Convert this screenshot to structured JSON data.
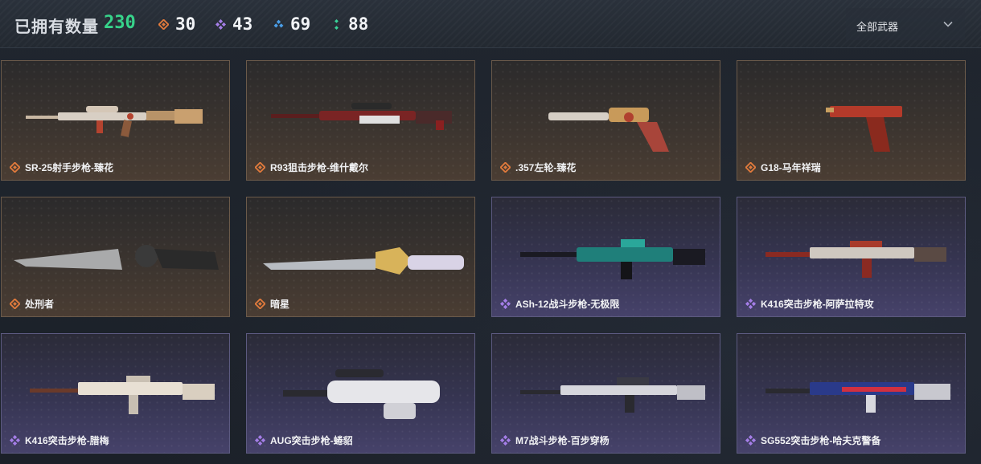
{
  "header": {
    "owned_label": "已拥有数量",
    "owned_count": "230",
    "stats": [
      {
        "icon": "orange-diamond-icon",
        "color": "#e07a3c",
        "count": "30"
      },
      {
        "icon": "purple-diamond-icon",
        "color": "#a57ee8",
        "count": "43"
      },
      {
        "icon": "blue-diamond-icon",
        "color": "#4a9ee8",
        "count": "69"
      },
      {
        "icon": "green-diamond-icon",
        "color": "#39d49a",
        "count": "88"
      }
    ],
    "filter": {
      "label": "全部武器",
      "icon": "chevron-down-icon"
    }
  },
  "cards": [
    {
      "name": "SR-25射手步枪-臻花",
      "rarity": "gold"
    },
    {
      "name": "R93狙击步枪-维什戴尔",
      "rarity": "gold"
    },
    {
      "name": ".357左轮-臻花",
      "rarity": "gold"
    },
    {
      "name": "G18-马年祥瑞",
      "rarity": "gold"
    },
    {
      "name": "处刑者",
      "rarity": "gold"
    },
    {
      "name": "暗星",
      "rarity": "gold"
    },
    {
      "name": "ASh-12战斗步枪-无极限",
      "rarity": "epic"
    },
    {
      "name": "K416突击步枪-阿萨拉特攻",
      "rarity": "epic"
    },
    {
      "name": "K416突击步枪-腊梅",
      "rarity": "epic"
    },
    {
      "name": "AUG突击步枪-蜷貂",
      "rarity": "epic"
    },
    {
      "name": "M7战斗步枪-百步穿杨",
      "rarity": "epic"
    },
    {
      "name": "SG552突击步枪-哈夫克警备",
      "rarity": "epic"
    }
  ],
  "colors": {
    "accent_green": "#37d38a",
    "rarity_gold": "#e07a3c",
    "rarity_epic": "#a57ee8"
  }
}
